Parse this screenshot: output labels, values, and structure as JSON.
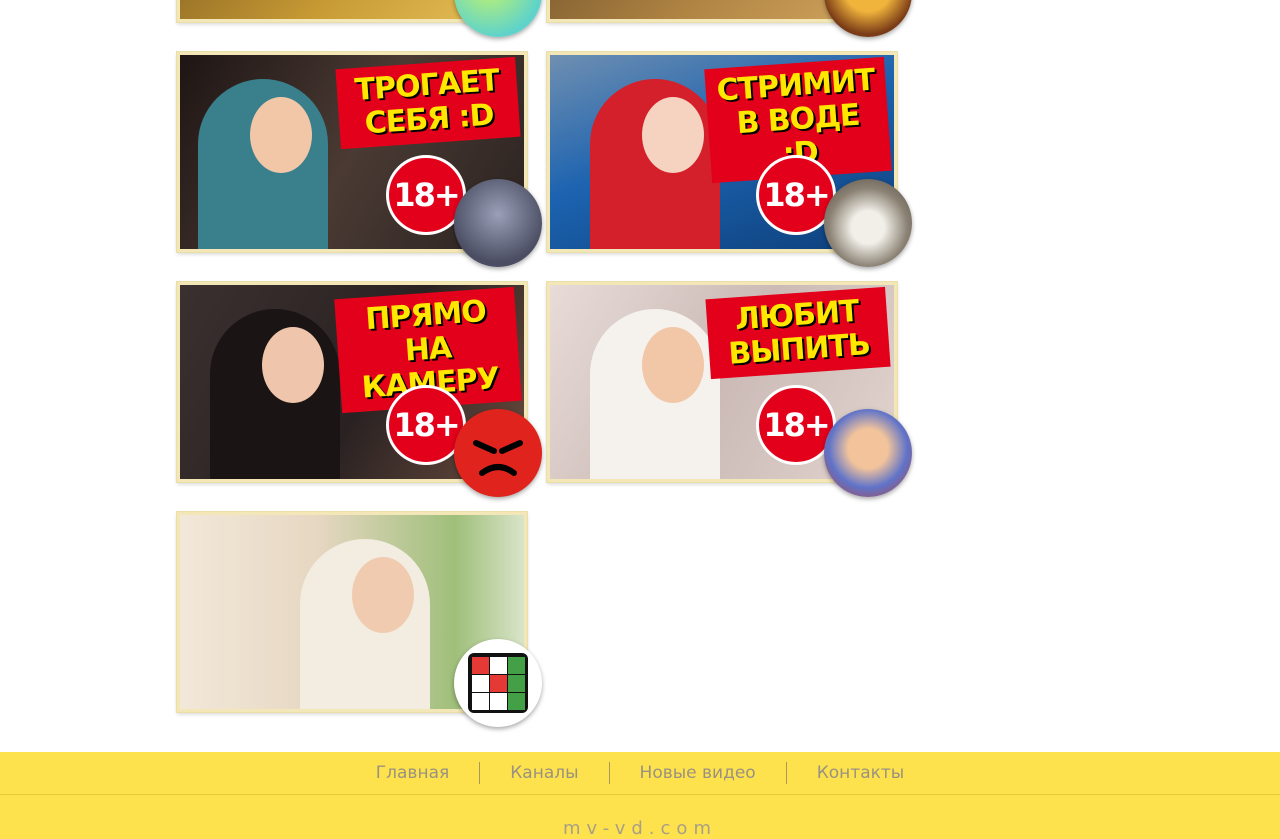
{
  "videos": [
    {
      "caption": "",
      "has_18_badge": false,
      "bg": "#b58a2e",
      "avatar_icon": "cartoon-avatar-icon",
      "avatar_color": "#7ed6c4"
    },
    {
      "caption": "",
      "has_18_badge": false,
      "bg": "#9c7a3c",
      "avatar_icon": "cartoon-avatar-icon",
      "avatar_color": "#d89a3c"
    },
    {
      "caption": "ТРОГАЕТ\nСЕБЯ :D",
      "badge": "18+",
      "has_18_badge": true,
      "bg": "#3b2b28",
      "avatar_icon": "cartoon-character-avatar-icon",
      "avatar_color": "#6a6f88"
    },
    {
      "caption": "СТРИМИТ\nВ ВОДЕ :D",
      "badge": "18+",
      "has_18_badge": true,
      "bg": "#1f6db5",
      "avatar_icon": "cat-avatar-icon",
      "avatar_color": "#8a8172"
    },
    {
      "caption": "ПРЯМО\nНА КАМЕРУ",
      "badge": "18+",
      "has_18_badge": true,
      "bg": "#2c2324",
      "avatar_icon": "angry-face-icon",
      "avatar_color": "#e0231d"
    },
    {
      "caption": "ЛЮБИТ\nВЫПИТЬ",
      "badge": "18+",
      "has_18_badge": true,
      "bg": "#d7c7c3",
      "avatar_icon": "anime-character-avatar-icon",
      "avatar_color": "#5f73c9"
    },
    {
      "caption": "",
      "has_18_badge": false,
      "bg": "#e5dccd",
      "avatar_icon": "rubiks-cube-icon",
      "avatar_color": "#ffffff"
    }
  ],
  "footer": {
    "nav": [
      "Главная",
      "Каналы",
      "Новые видео",
      "Контакты"
    ],
    "site_name": "mv-vd.com",
    "background": "#fde24d",
    "link_color": "#9a9280"
  }
}
